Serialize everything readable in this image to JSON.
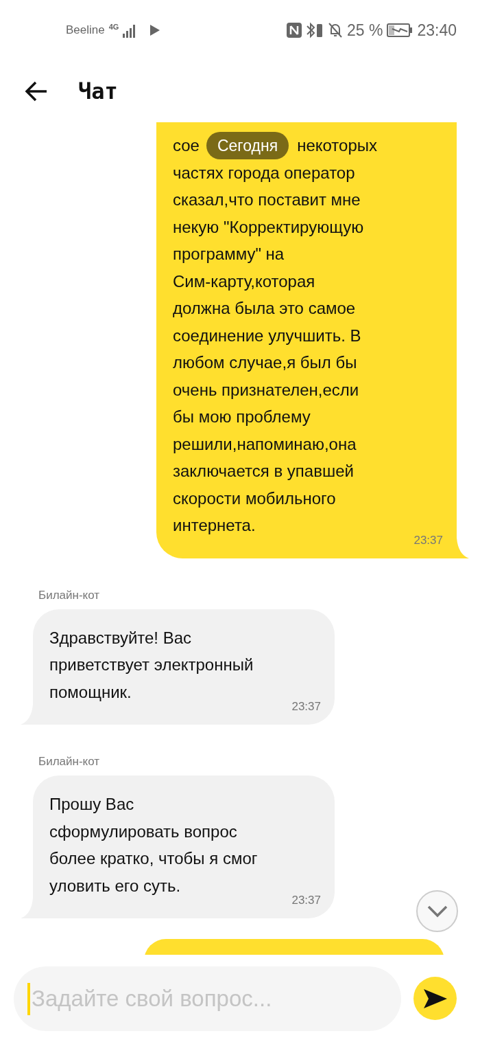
{
  "status_bar": {
    "carrier": "Beeline",
    "network": "4G",
    "battery": "25 %",
    "time": "23:40"
  },
  "header": {
    "title": "Чат"
  },
  "date_chip": "Сегодня",
  "messages": [
    {
      "kind": "outgoing",
      "covered_line": {
        "before": "сое",
        "after": "некоторых"
      },
      "text": "частях города оператор\nсказал,что поставит мне\nнекую \"Корректирующую\nпрограмму\" на\nСим-карту,которая\nдолжна была это самое\nсоединение улучшить. В\nлюбом случае,я был бы\nочень признателен,если\nбы мою проблему\nрешили,напоминаю,она\nзаключается в упавшей\nскорости мобильного\nинтернета.",
      "time": "23:37"
    },
    {
      "kind": "incoming",
      "sender": "Билайн-кот",
      "text": "Здравствуйте! Вас\nприветствует электронный\nпомощник.",
      "time": "23:37"
    },
    {
      "kind": "incoming",
      "sender": "Билайн-кот",
      "text": "Прошу Вас\nсформулировать вопрос\nболее кратко, чтобы я смог\nуловить его суть.",
      "time": "23:37"
    },
    {
      "kind": "outgoing_partial"
    }
  ],
  "composer": {
    "placeholder": "Задайте свой вопрос..."
  }
}
